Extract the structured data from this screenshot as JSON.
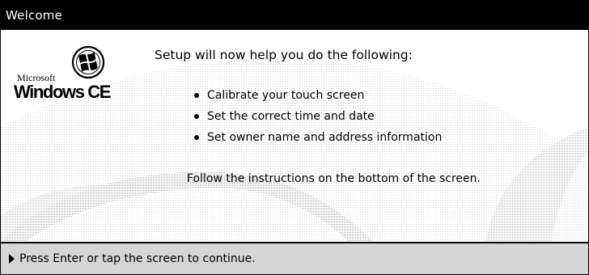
{
  "window": {
    "title": "Welcome"
  },
  "logo": {
    "microsoft": "Microsoft",
    "product": "Windows CE",
    "icon": "windows-flag-icon"
  },
  "content": {
    "heading": "Setup will now help you do the following:",
    "bullets": [
      "Calibrate your touch screen",
      "Set the correct time and date",
      "Set owner name and address information"
    ],
    "instructions": "Follow the instructions on the bottom of the screen."
  },
  "footer": {
    "prompt": "Press Enter or tap the screen to continue.",
    "icon": "play-arrow-icon"
  },
  "colors": {
    "titlebar_bg": "#000000",
    "titlebar_fg": "#ffffff",
    "footer_bg": "#d6d6d6"
  }
}
